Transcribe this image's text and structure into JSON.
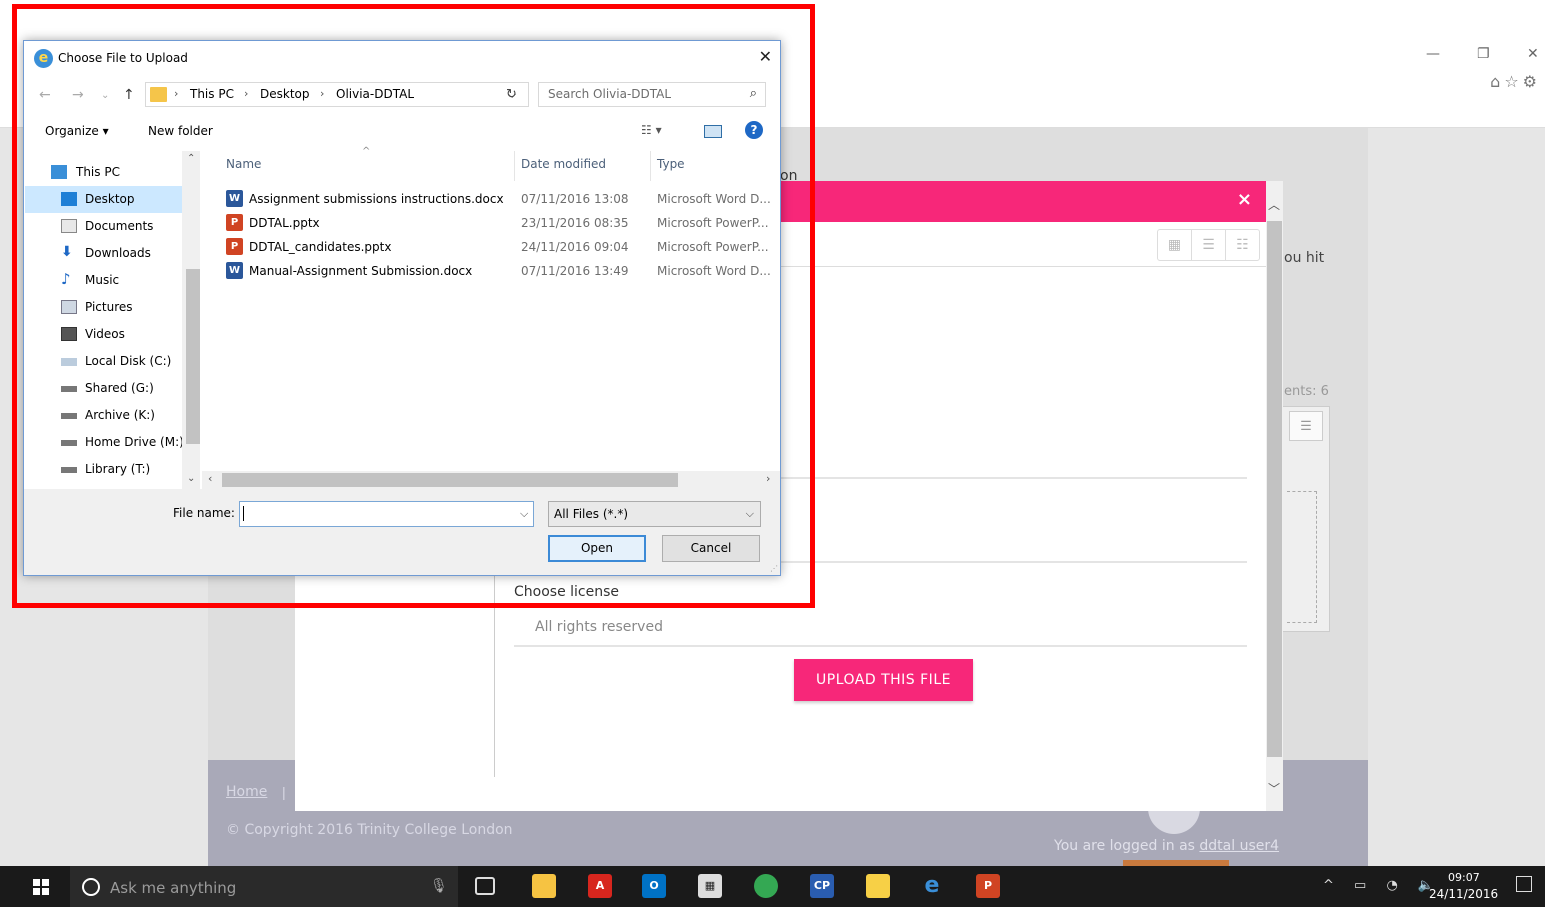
{
  "dialog": {
    "title": "Choose File to Upload",
    "breadcrumbs": [
      "This PC",
      "Desktop",
      "Olivia-DDTAL"
    ],
    "search_placeholder": "Search Olivia-DDTAL",
    "toolbar": {
      "organize": "Organize ▾",
      "new_folder": "New folder"
    },
    "nav_items": [
      {
        "label": "This PC",
        "icon": "pc-icon"
      },
      {
        "label": "Desktop",
        "icon": "desktop-icon"
      },
      {
        "label": "Documents",
        "icon": "documents-icon"
      },
      {
        "label": "Downloads",
        "icon": "downloads-icon"
      },
      {
        "label": "Music",
        "icon": "music-icon"
      },
      {
        "label": "Pictures",
        "icon": "pictures-icon"
      },
      {
        "label": "Videos",
        "icon": "videos-icon"
      },
      {
        "label": "Local Disk (C:)",
        "icon": "drive-icon"
      },
      {
        "label": "Shared (G:)",
        "icon": "network-drive-icon"
      },
      {
        "label": "Archive (K:)",
        "icon": "network-drive-icon"
      },
      {
        "label": "Home Drive (M:)",
        "icon": "network-drive-icon"
      },
      {
        "label": "Library (T:)",
        "icon": "network-drive-icon"
      }
    ],
    "selected_nav": "Desktop",
    "columns": [
      "Name",
      "Date modified",
      "Type"
    ],
    "files": [
      {
        "name": "Assignment submissions instructions.docx",
        "date": "07/11/2016 13:08",
        "type": "Microsoft Word D...",
        "kind": "word"
      },
      {
        "name": "DDTAL.pptx",
        "date": "23/11/2016 08:35",
        "type": "Microsoft PowerP...",
        "kind": "powerpoint"
      },
      {
        "name": "DDTAL_candidates.pptx",
        "date": "24/11/2016 09:04",
        "type": "Microsoft PowerP...",
        "kind": "powerpoint"
      },
      {
        "name": "Manual-Assignment Submission.docx",
        "date": "07/11/2016 13:49",
        "type": "Microsoft Word D...",
        "kind": "word"
      }
    ],
    "file_name_label": "File name:",
    "file_name_value": "",
    "file_type": "All Files (*.*)",
    "open_label": "Open",
    "cancel_label": "Cancel"
  },
  "background_page": {
    "text_on": "on",
    "text_hit": "ou hit",
    "text_ents": "ents: 6",
    "choose_license": "Choose license",
    "license_value": "All rights reserved",
    "upload_button": "UPLOAD THIS FILE",
    "modal_close": "×",
    "footer_home": "Home",
    "footer_sep": "|",
    "footer_copyright": "© Copyright 2016 Trinity College London",
    "footer_login_prefix": "You are logged in as ",
    "footer_login_user": "ddtal user4"
  },
  "taskbar": {
    "search_text": "Ask me anything",
    "time": "09:07",
    "date": "24/11/2016"
  },
  "colors": {
    "accent_pink": "#f72779",
    "highlight_red": "#ff0000",
    "selection_blue": "#cce8ff"
  }
}
